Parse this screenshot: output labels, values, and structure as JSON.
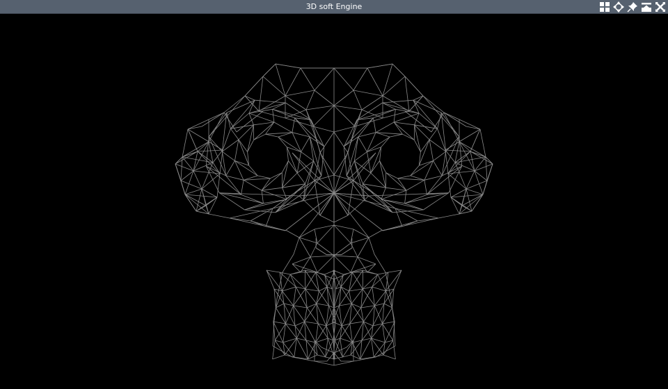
{
  "window": {
    "title": "3D soft Engine",
    "controls": [
      {
        "name": "tile-windows-icon"
      },
      {
        "name": "move-window-icon"
      },
      {
        "name": "pin-icon"
      },
      {
        "name": "shade-window-icon"
      },
      {
        "name": "close-icon"
      }
    ]
  },
  "viewport": {
    "background": "#000000",
    "wire_color": "#8a8a8a",
    "render_mode": "wireframe",
    "mesh": "monkey"
  }
}
